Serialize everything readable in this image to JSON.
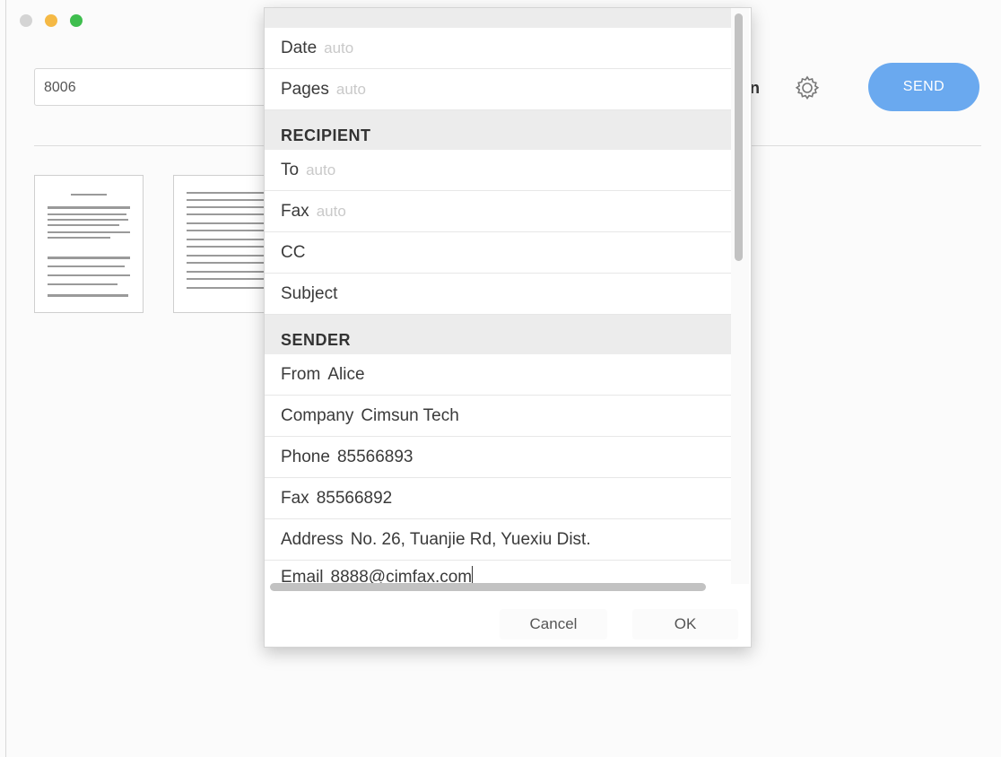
{
  "window": {
    "fax_number": "8006",
    "send_label": "SEND",
    "partial_label": "n"
  },
  "dialog": {
    "rows_top": [
      {
        "label": "Date",
        "placeholder": "auto"
      },
      {
        "label": "Pages",
        "placeholder": "auto"
      }
    ],
    "recipient": {
      "header": "RECIPIENT",
      "to": {
        "label": "To",
        "placeholder": "auto"
      },
      "fax": {
        "label": "Fax",
        "placeholder": "auto"
      },
      "cc": {
        "label": "CC"
      },
      "subject": {
        "label": "Subject"
      }
    },
    "sender": {
      "header": "SENDER",
      "from": {
        "label": "From",
        "value": "Alice"
      },
      "company": {
        "label": "Company",
        "value": "Cimsun Tech"
      },
      "phone": {
        "label": "Phone",
        "value": "85566893"
      },
      "fax": {
        "label": "Fax",
        "value": "85566892"
      },
      "address": {
        "label": "Address",
        "value": "No. 26, Tuanjie Rd, Yuexiu Dist."
      },
      "email": {
        "label": "Email",
        "value": "8888@cimfax.com"
      }
    },
    "cancel_label": "Cancel",
    "ok_label": "OK"
  }
}
